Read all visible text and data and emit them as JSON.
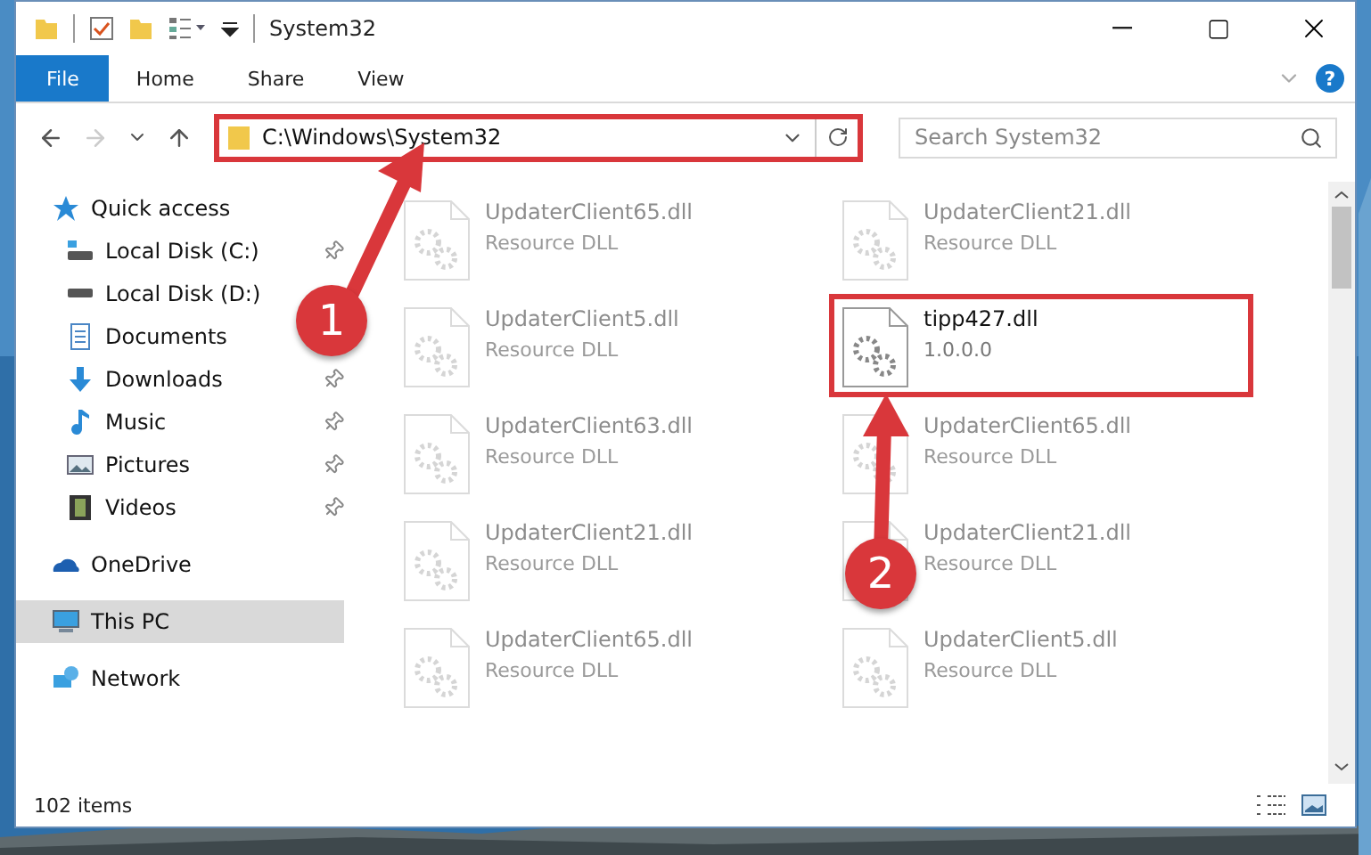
{
  "window": {
    "title": "System32"
  },
  "ribbon_tabs": [
    {
      "label": "File",
      "kind": "file"
    },
    {
      "label": "Home",
      "kind": "tab"
    },
    {
      "label": "Share",
      "kind": "tab"
    },
    {
      "label": "View",
      "kind": "tab"
    }
  ],
  "help_label": "?",
  "navigation": {
    "forward_disabled": true
  },
  "address": {
    "path": "C:\\Windows\\System32",
    "highlighted": true
  },
  "search": {
    "placeholder": "Search System32"
  },
  "sidebar": {
    "items": [
      {
        "label": "Quick access",
        "kind": "star",
        "selected": false,
        "children": [
          {
            "label": "Local Disk (C:)",
            "kind": "drive",
            "pinned": true,
            "selected": false
          },
          {
            "label": "Local Disk (D:)",
            "kind": "disk",
            "pinned": false,
            "selected": false
          },
          {
            "label": "Documents",
            "kind": "documents",
            "pinned": false,
            "selected": false
          },
          {
            "label": "Downloads",
            "kind": "downloads",
            "pinned": true,
            "selected": false
          },
          {
            "label": "Music",
            "kind": "music",
            "pinned": true,
            "selected": false
          },
          {
            "label": "Pictures",
            "kind": "pictures",
            "pinned": true,
            "selected": false
          },
          {
            "label": "Videos",
            "kind": "videos",
            "pinned": true,
            "selected": false
          }
        ]
      },
      {
        "label": "OneDrive",
        "kind": "cloud",
        "selected": false
      },
      {
        "label": "This PC",
        "kind": "pc",
        "selected": true
      },
      {
        "label": "Network",
        "kind": "network",
        "selected": false
      }
    ]
  },
  "files": [
    {
      "name": "UpdaterClient65.dll",
      "detail": "Resource DLL",
      "blurred": true,
      "highlighted": false
    },
    {
      "name": "UpdaterClient21.dll",
      "detail": "Resource DLL",
      "blurred": true,
      "highlighted": false
    },
    {
      "name": "UpdaterClient5.dll",
      "detail": "Resource DLL",
      "blurred": true,
      "highlighted": false
    },
    {
      "name": "tipp427.dll",
      "detail": "1.0.0.0",
      "blurred": false,
      "highlighted": true
    },
    {
      "name": "UpdaterClient63.dll",
      "detail": "Resource DLL",
      "blurred": true,
      "highlighted": false
    },
    {
      "name": "UpdaterClient65.dll",
      "detail": "Resource DLL",
      "blurred": true,
      "highlighted": false
    },
    {
      "name": "UpdaterClient21.dll",
      "detail": "Resource DLL",
      "blurred": true,
      "highlighted": false
    },
    {
      "name": "UpdaterClient21.dll",
      "detail": "Resource DLL",
      "blurred": true,
      "highlighted": false
    },
    {
      "name": "UpdaterClient65.dll",
      "detail": "Resource DLL",
      "blurred": true,
      "highlighted": false
    },
    {
      "name": "UpdaterClient5.dll",
      "detail": "Resource DLL",
      "blurred": true,
      "highlighted": false
    }
  ],
  "annotations": [
    {
      "label": "1"
    },
    {
      "label": "2"
    }
  ],
  "status_bar": {
    "count": "102 items"
  }
}
